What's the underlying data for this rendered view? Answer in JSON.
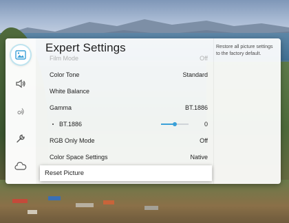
{
  "menu": {
    "title": "Expert Settings",
    "partial_item": {
      "label": "Film Mode",
      "value": "Off"
    },
    "items": [
      {
        "label": "Color Tone",
        "value": "Standard"
      },
      {
        "label": "White Balance",
        "value": ""
      },
      {
        "label": "Gamma",
        "value": "BT.1886"
      },
      {
        "label": "BT.1886",
        "value": "0"
      },
      {
        "label": "RGB Only Mode",
        "value": "Off"
      },
      {
        "label": "Color Space Settings",
        "value": "Native"
      }
    ],
    "reset_label": "Reset Picture",
    "help_text": "Restore all picture settings to the factory default.",
    "bt1886_slider_level": 0.5
  },
  "sidebar": {
    "icons": [
      "picture-icon",
      "sound-icon",
      "broadcasting-icon",
      "support-wrench-icon",
      "cloud-icon"
    ],
    "active": "picture-icon"
  },
  "colors": {
    "accent": "#3aa0d8",
    "active_ring": "#bfe4ef",
    "text": "#1e1e1e"
  }
}
